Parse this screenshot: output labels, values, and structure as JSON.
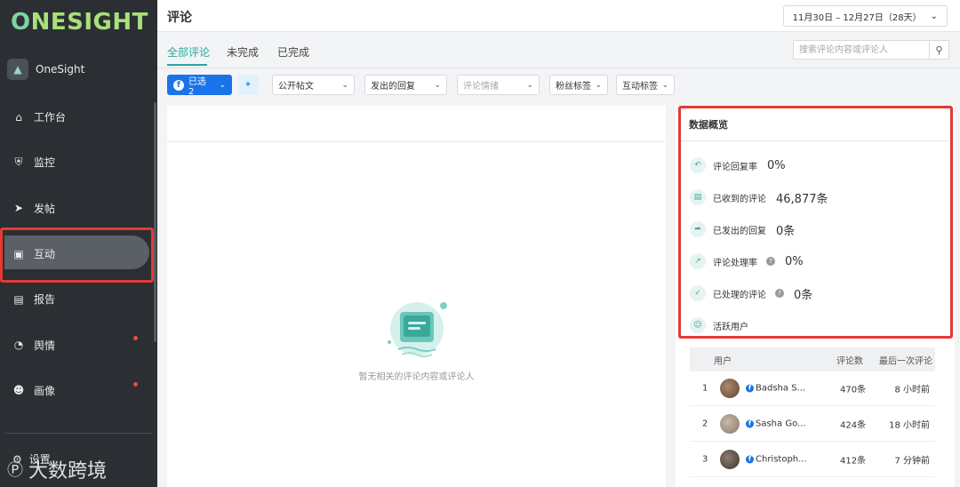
{
  "app": {
    "brand": "ONESIGHT",
    "brand_first": "O",
    "brand_rest": "NESIGHT",
    "org_name": "OneSight"
  },
  "sidebar": {
    "items": [
      {
        "label": "工作台",
        "icon": "home-icon"
      },
      {
        "label": "监控",
        "icon": "shield-icon"
      },
      {
        "label": "发帖",
        "icon": "send-icon"
      },
      {
        "label": "互动",
        "icon": "chat-icon",
        "active": true
      },
      {
        "label": "报告",
        "icon": "document-icon"
      },
      {
        "label": "舆情",
        "icon": "pie-chart-icon",
        "badge_dot": true
      },
      {
        "label": "画像",
        "icon": "users-icon",
        "badge_dot": true
      }
    ],
    "settings_label": "设置"
  },
  "watermark": {
    "text": "大数跨境"
  },
  "header": {
    "title": "评论",
    "date_range": "11月30日 – 12月27日（28天）"
  },
  "tabs": [
    {
      "label": "全部评论",
      "active": true
    },
    {
      "label": "未完成"
    },
    {
      "label": "已完成"
    }
  ],
  "search": {
    "placeholder": "搜索评论内容或评论人"
  },
  "filters": {
    "selected": "已选 2",
    "post_type": "公开帖文",
    "reply": "发出的回复",
    "sentiment_placeholder": "评论情绪",
    "fan_tag": "粉丝标签",
    "interaction_tag": "互动标签"
  },
  "empty_state": {
    "text": "暂无相关的评论内容或评论人"
  },
  "overview": {
    "title": "数据概览",
    "stats": [
      {
        "label": "评论回复率",
        "value": "0%",
        "icon": "reply-rate-icon"
      },
      {
        "label": "已收到的评论",
        "value": "46,877条",
        "icon": "comment-icon"
      },
      {
        "label": "已发出的回复",
        "value": "0条",
        "icon": "share-icon"
      },
      {
        "label": "评论处理率",
        "value": "0%",
        "icon": "trend-icon",
        "help": true
      },
      {
        "label": "已处理的评论",
        "value": "0条",
        "icon": "check-circle-icon",
        "help": true
      },
      {
        "label": "活跃用户",
        "value": "",
        "icon": "user-icon"
      }
    ]
  },
  "active_users": {
    "columns": [
      "用户",
      "评论数",
      "最后一次评论"
    ],
    "rows": [
      {
        "rank": "1",
        "name": "Badsha S...",
        "count": "470条",
        "last": "8 小时前"
      },
      {
        "rank": "2",
        "name": "Sasha Go...",
        "count": "424条",
        "last": "18 小时前"
      },
      {
        "rank": "3",
        "name": "Christoph...",
        "count": "412条",
        "last": "7 分钟前"
      }
    ]
  },
  "colors": {
    "accent": "#28a89a",
    "primary": "#1a73e8",
    "highlight": "#e53935",
    "sidebar_bg": "#2b2f33"
  }
}
